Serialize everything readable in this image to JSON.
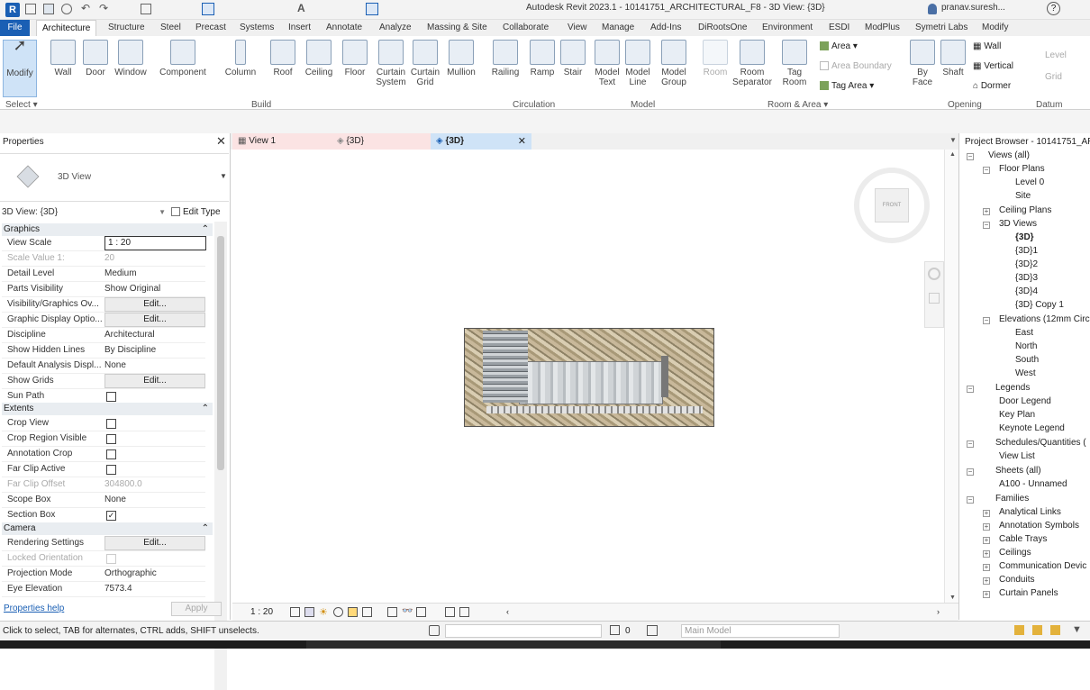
{
  "title": {
    "text": "Autodesk Revit 2023.1 - 10141751_ARCHITECTURAL_F8 - 3D View: {3D}",
    "user": "pranav.suresh..."
  },
  "menu_tabs": [
    "File",
    "Architecture",
    "Structure",
    "Steel",
    "Precast",
    "Systems",
    "Insert",
    "Annotate",
    "Analyze",
    "Massing & Site",
    "Collaborate",
    "View",
    "Manage",
    "Add-Ins",
    "DiRootsOne",
    "Environment",
    "ESDI",
    "ModPlus",
    "Symetri Labs",
    "Modify"
  ],
  "tools": [
    {
      "l1": "Modify",
      "l2": ""
    },
    {
      "l1": "Wall",
      "l2": ""
    },
    {
      "l1": "Door",
      "l2": ""
    },
    {
      "l1": "Window",
      "l2": ""
    },
    {
      "l1": "Component",
      "l2": ""
    },
    {
      "l1": "Column",
      "l2": ""
    },
    {
      "l1": "Roof",
      "l2": ""
    },
    {
      "l1": "Ceiling",
      "l2": ""
    },
    {
      "l1": "Floor",
      "l2": ""
    },
    {
      "l1": "Curtain",
      "l2": "System"
    },
    {
      "l1": "Curtain",
      "l2": "Grid"
    },
    {
      "l1": "Mullion",
      "l2": ""
    },
    {
      "l1": "Railing",
      "l2": ""
    },
    {
      "l1": "Ramp",
      "l2": ""
    },
    {
      "l1": "Stair",
      "l2": ""
    },
    {
      "l1": "Model",
      "l2": "Text"
    },
    {
      "l1": "Model",
      "l2": "Line"
    },
    {
      "l1": "Model",
      "l2": "Group"
    },
    {
      "l1": "Room",
      "l2": ""
    },
    {
      "l1": "Room",
      "l2": "Separator"
    },
    {
      "l1": "Tag",
      "l2": "Room"
    },
    {
      "l1": "By",
      "l2": "Face"
    },
    {
      "l1": "Shaft",
      "l2": ""
    }
  ],
  "small_tools": {
    "area": "Area",
    "area_boundary": "Area Boundary",
    "tag_area": "Tag Area",
    "wall": "Wall",
    "vertical": "Vertical",
    "dormer": "Dormer",
    "level": "Level",
    "grid": "Grid"
  },
  "groups": {
    "select": "Select",
    "build": "Build",
    "circulation": "Circulation",
    "model": "Model",
    "room_area": "Room & Area",
    "opening": "Opening",
    "datum": "Datum"
  },
  "properties": {
    "title": "Properties",
    "type_name": "3D View",
    "instance": "3D View: {3D}",
    "edit_type": "Edit Type",
    "sections": {
      "graphics": "Graphics",
      "extents": "Extents",
      "camera": "Camera"
    },
    "rows": [
      {
        "k": "View Scale",
        "v": "1 : 20"
      },
      {
        "k": "Scale Value    1:",
        "v": "20"
      },
      {
        "k": "Detail Level",
        "v": "Medium"
      },
      {
        "k": "Parts Visibility",
        "v": "Show Original"
      },
      {
        "k": "Visibility/Graphics Ov...",
        "v": "Edit..."
      },
      {
        "k": "Graphic Display Optio...",
        "v": "Edit..."
      },
      {
        "k": "Discipline",
        "v": "Architectural"
      },
      {
        "k": "Show Hidden Lines",
        "v": "By Discipline"
      },
      {
        "k": "Default Analysis Displ...",
        "v": "None"
      },
      {
        "k": "Show Grids",
        "v": "Edit..."
      },
      {
        "k": "Sun Path",
        "v": ""
      },
      {
        "k": "Crop View",
        "v": ""
      },
      {
        "k": "Crop Region Visible",
        "v": ""
      },
      {
        "k": "Annotation Crop",
        "v": ""
      },
      {
        "k": "Far Clip Active",
        "v": ""
      },
      {
        "k": "Far Clip Offset",
        "v": "304800.0"
      },
      {
        "k": "Scope Box",
        "v": "None"
      },
      {
        "k": "Section Box",
        "v": "✓"
      },
      {
        "k": "Rendering Settings",
        "v": "Edit..."
      },
      {
        "k": "Locked Orientation",
        "v": ""
      },
      {
        "k": "Projection Mode",
        "v": "Orthographic"
      },
      {
        "k": "Eye Elevation",
        "v": "7573.4"
      }
    ],
    "help": "Properties help",
    "apply": "Apply"
  },
  "view_tabs": [
    {
      "label": "View 1"
    },
    {
      "label": "{3D}"
    },
    {
      "label": "{3D}"
    }
  ],
  "browser": {
    "title": "Project Browser - 10141751_AR",
    "items": [
      "Views (all)",
      "Floor Plans",
      "Level 0",
      "Site",
      "Ceiling Plans",
      "3D Views",
      "{3D}",
      "{3D}1",
      "{3D}2",
      "{3D}3",
      "{3D}4",
      "{3D} Copy 1",
      "Elevations (12mm Circ",
      "East",
      "North",
      "South",
      "West",
      "Legends",
      "Door Legend",
      "Key Plan",
      "Keynote Legend",
      "Schedules/Quantities (",
      "View List",
      "Sheets (all)",
      "A100 - Unnamed",
      "Families",
      "Analytical Links",
      "Annotation Symbols",
      "Cable Trays",
      "Ceilings",
      "Communication Devic",
      "Conduits",
      "Curtain Panels"
    ]
  },
  "status": {
    "hint": "Click to select, TAB for alternates, CTRL adds, SHIFT unselects.",
    "scale": "1 : 20",
    "zero": "0",
    "main_model": "Main Model"
  },
  "viewcube": {
    "label": "FRONT"
  }
}
